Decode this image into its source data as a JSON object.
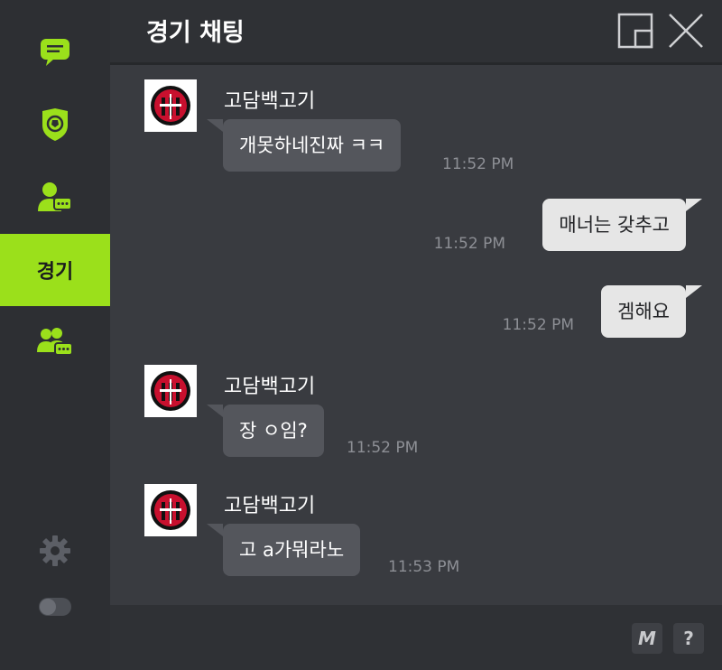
{
  "sidebar": {
    "items": [
      {
        "name": "chat-icon"
      },
      {
        "name": "shield-ball-icon"
      },
      {
        "name": "user-chat-icon"
      },
      {
        "label": "경기"
      },
      {
        "name": "group-chat-icon"
      }
    ],
    "settings_icon": "gear-icon",
    "toggle_icon": "toggle-icon",
    "accent_color": "#9be01b"
  },
  "header": {
    "title": "경기 채팅"
  },
  "messages": [
    {
      "type": "theirs",
      "sender": "고담백고기",
      "text": "개못하네진짜 ㅋㅋ",
      "time": "11:52 PM"
    },
    {
      "type": "mine",
      "text": "매너는 갖추고",
      "time": "11:52 PM"
    },
    {
      "type": "mine",
      "text": "겜해요",
      "time": "11:52 PM"
    },
    {
      "type": "theirs",
      "sender": "고담백고기",
      "text": "장 ㅇ임?",
      "time": "11:52 PM"
    },
    {
      "type": "theirs",
      "sender": "고담백고기",
      "text": "고 a가뭐라노",
      "time": "11:53 PM"
    }
  ],
  "footer": {
    "m_label": "M",
    "help_label": "?"
  }
}
